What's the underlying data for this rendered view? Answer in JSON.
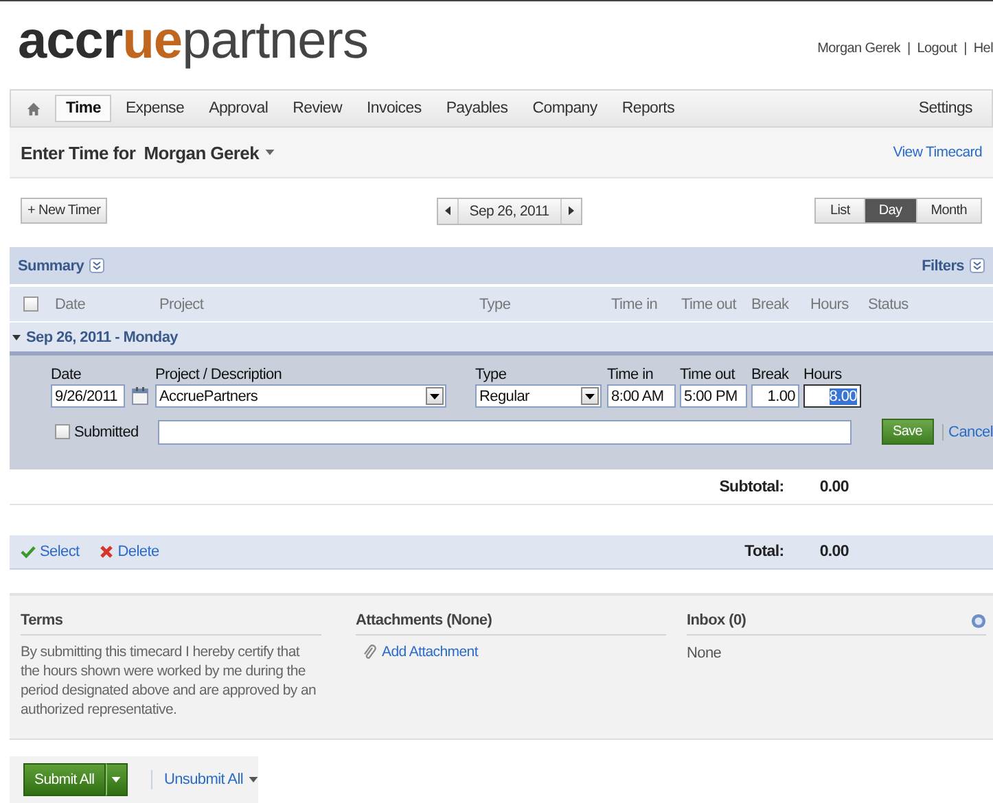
{
  "header": {
    "logo": [
      {
        "text": "accr",
        "kind": "strong"
      },
      {
        "text": "ue",
        "kind": "accent"
      },
      {
        "text": "partners",
        "kind": "plain"
      }
    ],
    "user_links": [
      {
        "label": "Morgan Gerek"
      },
      {
        "label": "Logout"
      },
      {
        "label": "Hel"
      }
    ],
    "separator": "|"
  },
  "nav": {
    "tabs": [
      {
        "label": "Time",
        "selected": true
      },
      {
        "label": "Expense",
        "selected": false
      },
      {
        "label": "Approval",
        "selected": false
      },
      {
        "label": "Review",
        "selected": false
      },
      {
        "label": "Invoices",
        "selected": false
      },
      {
        "label": "Payables",
        "selected": false
      },
      {
        "label": "Company",
        "selected": false
      },
      {
        "label": "Reports",
        "selected": false
      }
    ],
    "settings": "Settings"
  },
  "page_title": {
    "prefix": "Enter Time for",
    "user": "Morgan Gerek",
    "view_timecard": "View Timecard"
  },
  "toolbar": {
    "new_timer": "+ New Timer",
    "date": "Sep 26, 2011",
    "views": [
      {
        "label": "List",
        "selected": false
      },
      {
        "label": "Day",
        "selected": true
      },
      {
        "label": "Month",
        "selected": false
      }
    ]
  },
  "summary": {
    "title": "Summary",
    "filters": "Filters"
  },
  "columns": [
    "Date",
    "Project",
    "Type",
    "Time in",
    "Time out",
    "Break",
    "Hours",
    "Status"
  ],
  "select_all_checked": false,
  "day_group": {
    "label": "Sep 26, 2011 - Monday",
    "expanded": true
  },
  "edit_row": {
    "labels": [
      "Date",
      "Project / Description",
      "Type",
      "Time in",
      "Time out",
      "Break",
      "Hours"
    ],
    "date": "9/26/2011",
    "project": "AccruePartners",
    "type": "Regular",
    "time_in": "8:00 AM",
    "time_out": "5:00 PM",
    "break": "1.00",
    "hours": "8.00",
    "hours_highlighted": true,
    "submitted_label": "Submitted",
    "submitted": false,
    "save": "Save",
    "cancel": "Cancel"
  },
  "subtotal": {
    "label": "Subtotal:",
    "value": "0.00"
  },
  "actions": [
    {
      "label": "Select",
      "kind": "select"
    },
    {
      "label": "Delete",
      "kind": "delete"
    }
  ],
  "total": {
    "label": "Total:",
    "value": "0.00"
  },
  "terms": {
    "title": "Terms",
    "text": "By submitting this timecard I hereby certify that the hours shown were worked by me during the period designated above and are approved by an authorized representative."
  },
  "attachments": {
    "title": "Attachments (None)",
    "link": "Add Attachment"
  },
  "inbox": {
    "title": "Inbox (0)",
    "text": "None"
  },
  "footer": {
    "submit": "Submit All",
    "unsubmit": "Unsubmit All"
  }
}
